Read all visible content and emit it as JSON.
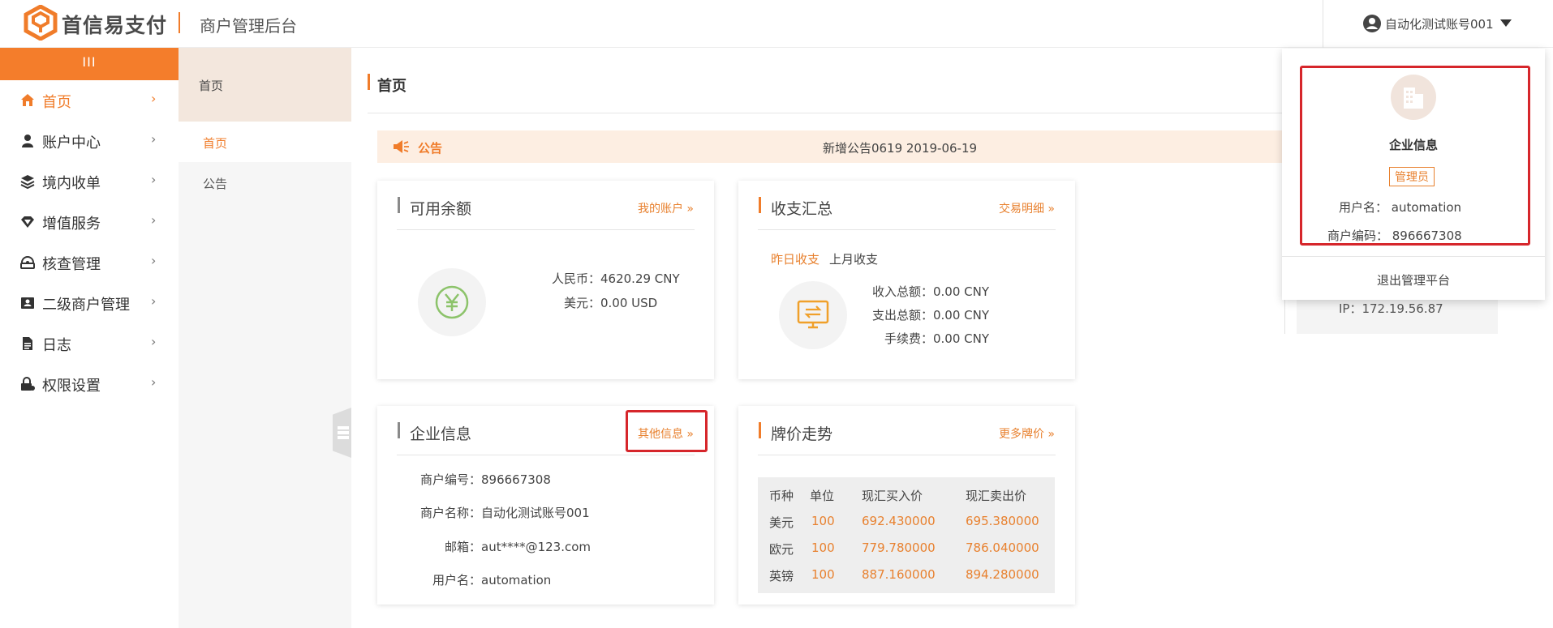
{
  "header": {
    "brand": "首信易支付",
    "system_title": "商户管理后台",
    "user_name": "自动化测试账号001"
  },
  "sidebar": {
    "toggle": "III",
    "items": [
      {
        "label": "首页",
        "icon": "home-icon"
      },
      {
        "label": "账户中心",
        "icon": "user-icon"
      },
      {
        "label": "境内收单",
        "icon": "layers-icon"
      },
      {
        "label": "增值服务",
        "icon": "diamond-icon"
      },
      {
        "label": "核查管理",
        "icon": "check-icon"
      },
      {
        "label": "二级商户管理",
        "icon": "id-card-icon"
      },
      {
        "label": "日志",
        "icon": "document-icon"
      },
      {
        "label": "权限设置",
        "icon": "lock-icon"
      }
    ]
  },
  "subnav": {
    "header": "首页",
    "items": [
      "首页",
      "公告"
    ]
  },
  "main": {
    "page_title": "首页",
    "notice": {
      "label": "公告",
      "text": "新增公告0619 2019-06-19"
    },
    "balance": {
      "title": "可用余额",
      "link": "我的账户 »",
      "rmb_label": "人民币：",
      "rmb_value": "4620.29 CNY",
      "usd_label": "美元：",
      "usd_value": "0.00 USD"
    },
    "summary": {
      "title": "收支汇总",
      "link": "交易明细 »",
      "tab_yesterday": "昨日收支",
      "tab_last_month": "上月收支",
      "income_label": "收入总额：",
      "income_value": "0.00 CNY",
      "expense_label": "支出总额：",
      "expense_value": "0.00 CNY",
      "fee_label": "手续费：",
      "fee_value": "0.00 CNY"
    },
    "company": {
      "title": "企业信息",
      "link": "其他信息 »",
      "merchant_no_label": "商户编号：",
      "merchant_no": "896667308",
      "merchant_name_label": "商户名称：",
      "merchant_name": "自动化测试账号001",
      "email_label": "邮箱：",
      "email": "aut****@123.com",
      "username_label": "用户名：",
      "username": "automation"
    },
    "rates": {
      "title": "牌价走势",
      "link": "更多牌价 »",
      "headers": [
        "币种",
        "单位",
        "现汇买入价",
        "现汇卖出价"
      ],
      "rows": [
        [
          "美元",
          "100",
          "692.430000",
          "695.380000"
        ],
        [
          "欧元",
          "100",
          "779.780000",
          "786.040000"
        ],
        [
          "英镑",
          "100",
          "887.160000",
          "894.280000"
        ]
      ]
    },
    "ip": "IP：172.19.56.87"
  },
  "dropdown": {
    "title": "企业信息",
    "role_badge": "管理员",
    "username_line": "用户名： automation",
    "code_line": "商户编码： 896667308",
    "logout": "退出管理平台"
  },
  "colors": {
    "accent": "#f07c2a",
    "highlight": "#d6262b"
  }
}
